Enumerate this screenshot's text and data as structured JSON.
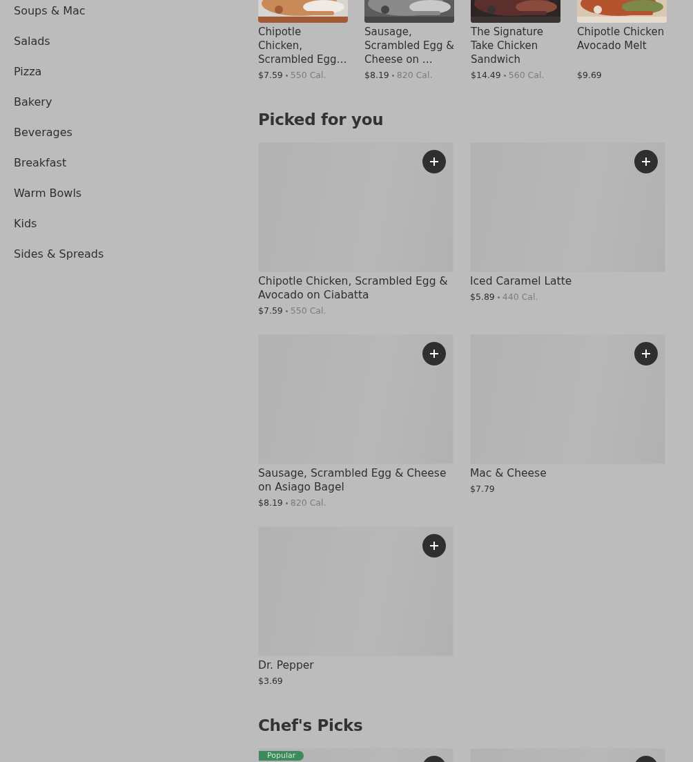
{
  "sidebar": {
    "items": [
      {
        "label": "Soups & Mac"
      },
      {
        "label": "Salads"
      },
      {
        "label": "Pizza"
      },
      {
        "label": "Bakery"
      },
      {
        "label": "Beverages"
      },
      {
        "label": "Breakfast"
      },
      {
        "label": "Warm Bowls"
      },
      {
        "label": "Kids"
      },
      {
        "label": "Sides & Spreads"
      }
    ]
  },
  "carousel": {
    "items": [
      {
        "title": "Chipotle Chicken, Scrambled Egg…",
        "price": "$7.59",
        "calories": "550 Cal."
      },
      {
        "title": "Sausage, Scrambled Egg & Cheese on …",
        "price": "$8.19",
        "calories": "820 Cal."
      },
      {
        "title": "The Signature Take Chicken Sandwich",
        "price": "$14.49",
        "calories": "560 Cal."
      },
      {
        "title": "Chipotle Chicken Avocado Melt",
        "price": "$9.69"
      }
    ]
  },
  "sections": [
    {
      "title": "Picked for you",
      "items": [
        {
          "kind": "item",
          "title": "Chipotle Chicken, Scrambled Egg & Avocado on Ciabatta",
          "price": "$7.59",
          "calories": "550 Cal."
        },
        {
          "kind": "item",
          "title": "Iced Caramel Latte",
          "price": "$5.89",
          "calories": "440 Cal."
        },
        {
          "kind": "item",
          "title": "Sausage, Scrambled Egg & Cheese on Asiago Bagel",
          "price": "$8.19",
          "calories": "820 Cal."
        },
        {
          "kind": "item",
          "title": "Mac & Cheese",
          "price": "$7.79"
        },
        {
          "kind": "item",
          "title": "Dr. Pepper",
          "price": "$3.69"
        }
      ]
    },
    {
      "title": "Chef's Picks",
      "items": [
        {
          "kind": "item",
          "badge": "Popular"
        },
        {
          "kind": "item"
        }
      ]
    }
  ]
}
